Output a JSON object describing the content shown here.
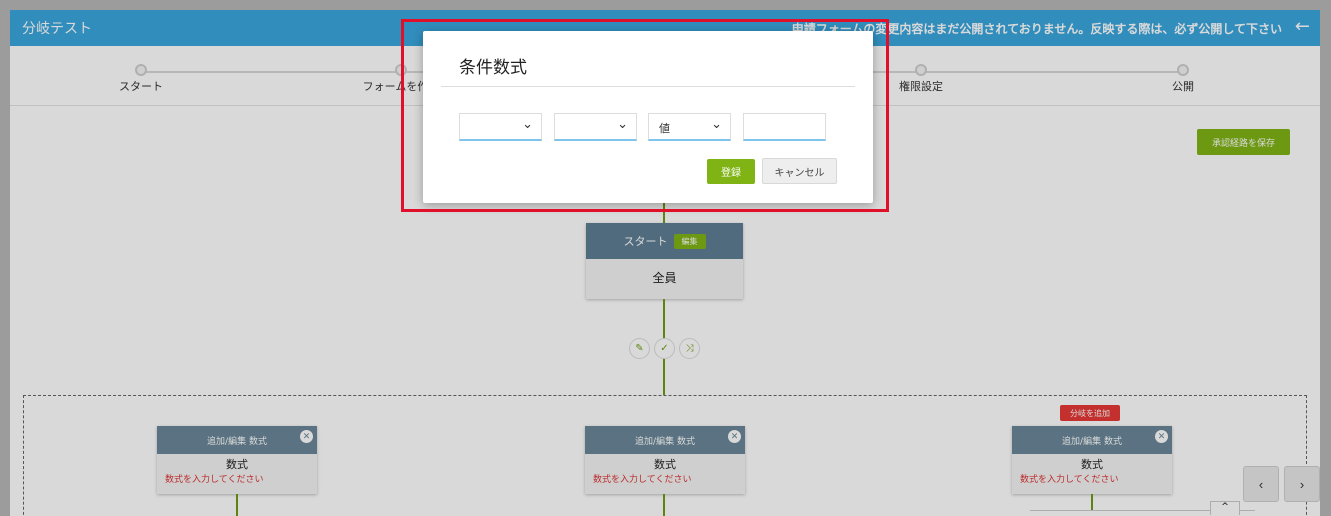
{
  "app": {
    "title": "分岐テスト",
    "notice": "申請フォームの変更内容はまだ公開されておりません。反映する際は、必ず公開して下さい",
    "back_icon": "arrow-left-icon"
  },
  "steps": [
    {
      "label": "スタート"
    },
    {
      "label": "フォームを作成"
    },
    {
      "label": ""
    },
    {
      "label": ""
    },
    {
      "label": "権限設定"
    },
    {
      "label": "公開"
    }
  ],
  "toolbar": {
    "save_route_label": "承認経路を保存"
  },
  "start_node": {
    "title": "スタート",
    "edit_label": "編集",
    "body": "全員"
  },
  "actions": [
    {
      "icon": "pencil-icon",
      "glyph": "✎"
    },
    {
      "icon": "check-icon",
      "glyph": "✓"
    },
    {
      "icon": "shuffle-icon",
      "glyph": "⤨"
    }
  ],
  "branches": {
    "add_label": "分岐を追加",
    "conditions": [
      {
        "title": "追加/編集 数式",
        "name": "数式",
        "warning": "数式を入力してください"
      },
      {
        "title": "追加/編集 数式",
        "name": "数式",
        "warning": "数式を入力してください"
      },
      {
        "title": "追加/編集 数式",
        "name": "数式",
        "warning": "数式を入力してください"
      }
    ]
  },
  "pager": {
    "prev": "‹",
    "next": "›",
    "up": "^"
  },
  "modal": {
    "title": "条件数式",
    "fields": [
      {
        "type": "select",
        "value": ""
      },
      {
        "type": "select",
        "value": ""
      },
      {
        "type": "select",
        "value": "値"
      },
      {
        "type": "text",
        "value": ""
      }
    ],
    "register_label": "登録",
    "cancel_label": "キャンセル"
  },
  "colors": {
    "accent": "#7fb414",
    "header": "#3aa6dd",
    "highlight": "#e0102a",
    "danger": "#e53935"
  }
}
